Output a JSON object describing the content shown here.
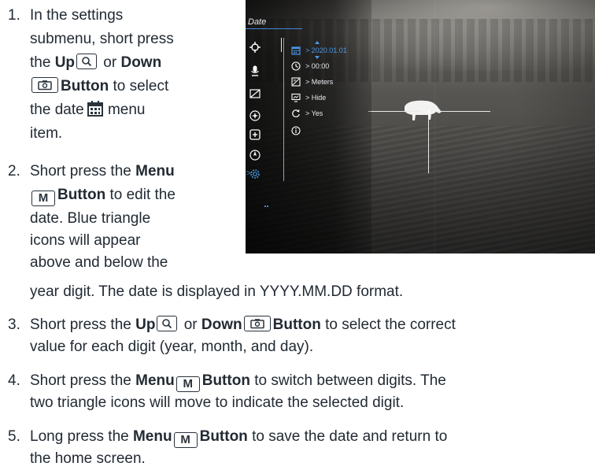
{
  "steps": [
    {
      "num": "1.",
      "l1": "In the settings",
      "l2": "submenu, short press",
      "l3_a": "the ",
      "l3_b": "Up",
      "l3_c": " or ",
      "l3_d": "Down",
      "l4_b": "Button",
      "l4_c": " to select",
      "l5_a": "the date",
      "l5_c": " menu",
      "l6": "item."
    },
    {
      "num": "2.",
      "l1_a": "Short press the ",
      "l1_b": "Menu",
      "l2_b": "Button",
      "l2_c": " to edit the",
      "l3": "date. Blue triangle",
      "l4": "icons will appear",
      "l5": "above and below the",
      "l6": "year digit. The date is displayed in YYYY.MM.DD format."
    },
    {
      "num": "3.",
      "l1_a": "Short press the ",
      "l1_b": "Up",
      "l1_c": " or ",
      "l1_d": "Down",
      "l1_e": "Button",
      "l1_f": " to select the correct",
      "l2": "value for each digit (year, month, and day)."
    },
    {
      "num": "4.",
      "l1_a": "Short press the ",
      "l1_b": "Menu",
      "l1_c": "Button",
      "l1_d": " to switch between digits. The",
      "l2": "two triangle icons will move to indicate the selected digit."
    },
    {
      "num": "5.",
      "l1_a": "Long press the ",
      "l1_b": "Menu",
      "l1_c": "Button",
      "l1_d": " to save the date and return to",
      "l2": "the home screen."
    }
  ],
  "key_m": "M",
  "screen": {
    "tab": "Date",
    "items": [
      {
        "icon": "calendar-icon",
        "value": "> 2020.01.01"
      },
      {
        "icon": "clock-icon",
        "value": "> 00:00"
      },
      {
        "icon": "units-icon",
        "value": "> Meters"
      },
      {
        "icon": "display-icon",
        "value": "> Hide"
      },
      {
        "icon": "reset-icon",
        "value": "> Yes"
      },
      {
        "icon": "info-icon",
        "value": ""
      }
    ],
    "selected_arrow": ">",
    "accent": "#4a98e6",
    "side_icons": [
      "crosshair-icon",
      "microphone-icon",
      "calibration-icon",
      "brightness-icon",
      "zoom-plus-icon",
      "compass-icon",
      "settings-gear-icon"
    ]
  }
}
